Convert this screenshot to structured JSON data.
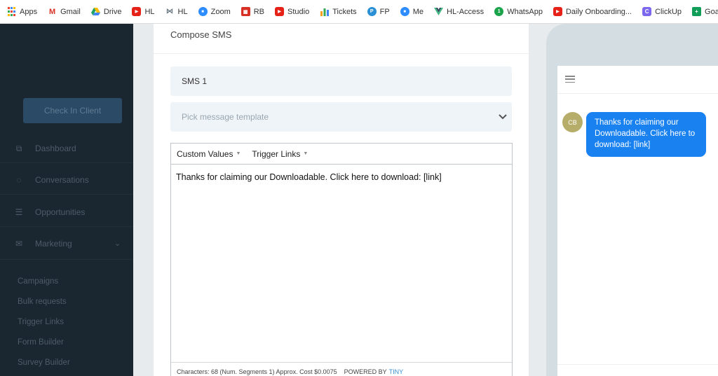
{
  "bookmarks": [
    {
      "label": "Apps",
      "icon": "apps-grid-icon",
      "color": "#4285f4"
    },
    {
      "label": "Gmail",
      "icon": "gmail-icon",
      "color": "#d93025"
    },
    {
      "label": "Drive",
      "icon": "drive-icon",
      "color": "#1fa463"
    },
    {
      "label": "HL",
      "icon": "youtube-icon",
      "color": "#e62117"
    },
    {
      "label": "HL",
      "icon": "wireframe-icon",
      "color": "#6b7b86"
    },
    {
      "label": "Zoom",
      "icon": "zoom-icon",
      "color": "#2d8cff"
    },
    {
      "label": "RB",
      "icon": "building-icon",
      "color": "#d93025"
    },
    {
      "label": "Studio",
      "icon": "youtube-icon",
      "color": "#e62117"
    },
    {
      "label": "Tickets",
      "icon": "chart-bars-icon",
      "color": "#f4a21c"
    },
    {
      "label": "FP",
      "icon": "fp-icon",
      "color": "#2a8fd4"
    },
    {
      "label": "Me",
      "icon": "zoom-icon",
      "color": "#2d8cff"
    },
    {
      "label": "HL-Access",
      "icon": "vue-icon",
      "color": "#41b883"
    },
    {
      "label": "WhatsApp",
      "icon": "whatsapp-icon",
      "color": "#1aa34a"
    },
    {
      "label": "Daily Onboarding...",
      "icon": "youtube-icon",
      "color": "#e62117"
    },
    {
      "label": "ClickUp",
      "icon": "clickup-icon",
      "color": "#7b68ee"
    },
    {
      "label": "Goals",
      "icon": "sheets-icon",
      "color": "#0f9d58"
    }
  ],
  "sidebar": {
    "check_in_label": "Check In Client",
    "nav": [
      {
        "label": "Dashboard",
        "icon": "dashboard-icon"
      },
      {
        "label": "Conversations",
        "icon": "chat-icon"
      },
      {
        "label": "Opportunities",
        "icon": "opportunities-icon"
      },
      {
        "label": "Marketing",
        "icon": "mail-icon"
      }
    ],
    "sub_items": [
      "Campaigns",
      "Bulk requests",
      "Trigger Links",
      "Form Builder",
      "Survey Builder"
    ]
  },
  "compose": {
    "title": "Compose SMS",
    "name_value": "SMS 1",
    "template_placeholder": "Pick message template",
    "toolbar": {
      "custom_values": "Custom Values",
      "trigger_links": "Trigger Links"
    },
    "message": "Thanks for claiming our Downloadable. Click here to download: [link]",
    "status": "Characters: 68 (Num. Segments 1) Approx. Cost $0.0075",
    "powered_by": "POWERED BY",
    "powered_brand": "TINY"
  },
  "preview": {
    "avatar_initials": "CB",
    "bubble_text": "Thanks for claiming our Downloadable. Click here to download: [link]",
    "bubble_color": "#1a82f0"
  }
}
